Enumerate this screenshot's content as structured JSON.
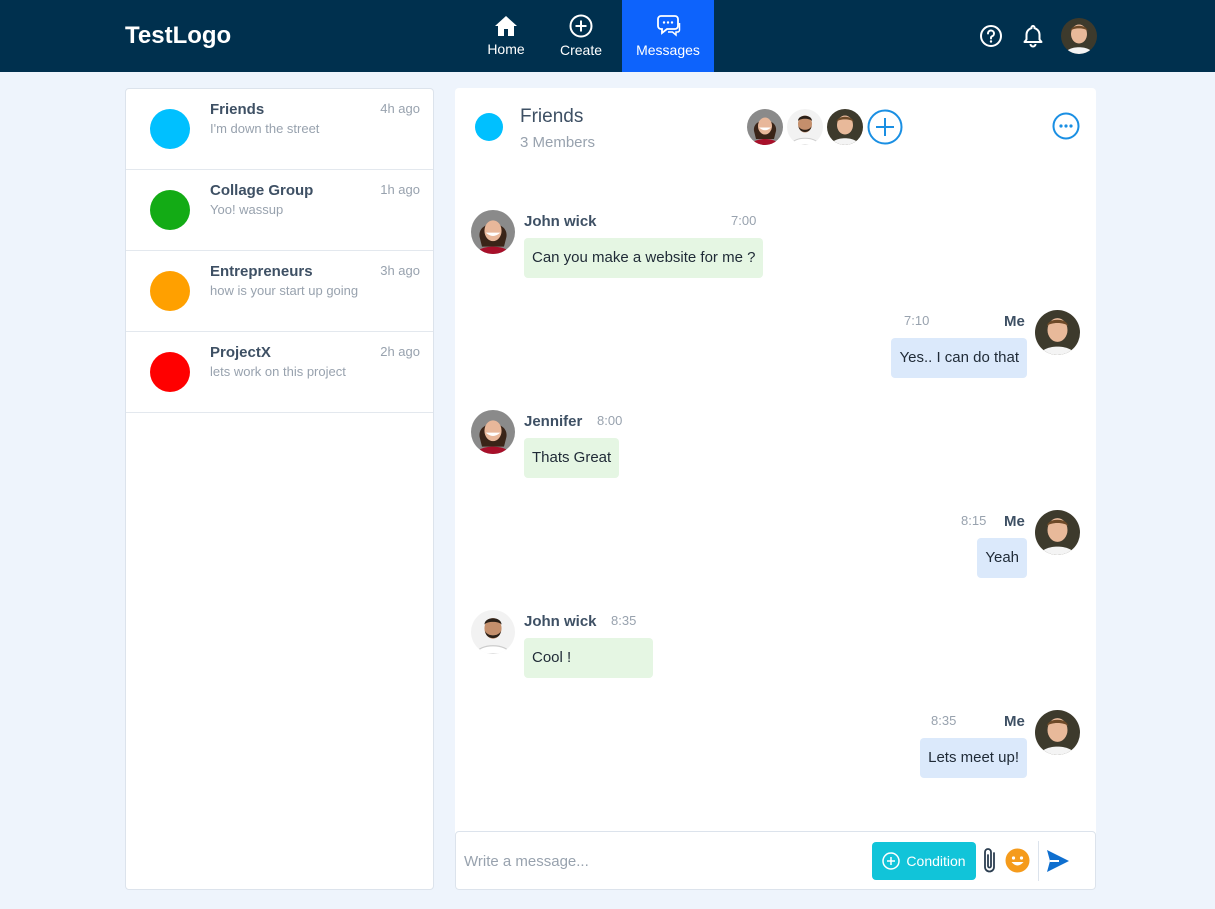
{
  "header": {
    "logo": "TestLogo",
    "nav": [
      {
        "label": "Home",
        "icon": "home-icon"
      },
      {
        "label": "Create",
        "icon": "plus-circle-icon"
      },
      {
        "label": "Messages",
        "icon": "chat-bubbles-icon",
        "active": true
      }
    ],
    "right_icons": [
      "help-icon",
      "bell-icon",
      "user-avatar"
    ]
  },
  "conversations": [
    {
      "name": "Friends",
      "preview": "I'm down the street",
      "time": "4h ago",
      "color": "#00c0ff"
    },
    {
      "name": "Collage Group",
      "preview": "Yoo! wassup",
      "time": "1h ago",
      "color": "#13ab15"
    },
    {
      "name": "Entrepreneurs",
      "preview": "how is your start up going",
      "time": "3h ago",
      "color": "#ffa000"
    },
    {
      "name": "ProjectX",
      "preview": "lets work on this project",
      "time": "2h ago",
      "color": "#ff0000"
    }
  ],
  "chat": {
    "title": "Friends",
    "members": "3 Members",
    "color": "#00c0ff",
    "messages": [
      {
        "sender": "John wick",
        "time": "7:00",
        "text": "Can you make a website for me ?",
        "direction": "in"
      },
      {
        "sender": "Me",
        "time": "7:10",
        "text": "Yes.. I can do that",
        "direction": "out"
      },
      {
        "sender": "Jennifer",
        "time": "8:00",
        "text": "Thats Great",
        "direction": "in"
      },
      {
        "sender": "Me",
        "time": "8:15",
        "text": "Yeah",
        "direction": "out"
      },
      {
        "sender": "John wick",
        "time": "8:35",
        "text": "Cool !",
        "direction": "in"
      },
      {
        "sender": "Me",
        "time": "8:35",
        "text": "Lets meet up!",
        "direction": "out"
      }
    ]
  },
  "composer": {
    "placeholder": "Write a message...",
    "condition_label": "Condition"
  },
  "colors": {
    "navbar": "#00304e",
    "active_nav": "#0d63fc",
    "accent": "#1a8fe3",
    "condition": "#11c4d9",
    "incoming_bubble": "#e5f6e3",
    "outgoing_bubble": "#dbe9fb"
  }
}
